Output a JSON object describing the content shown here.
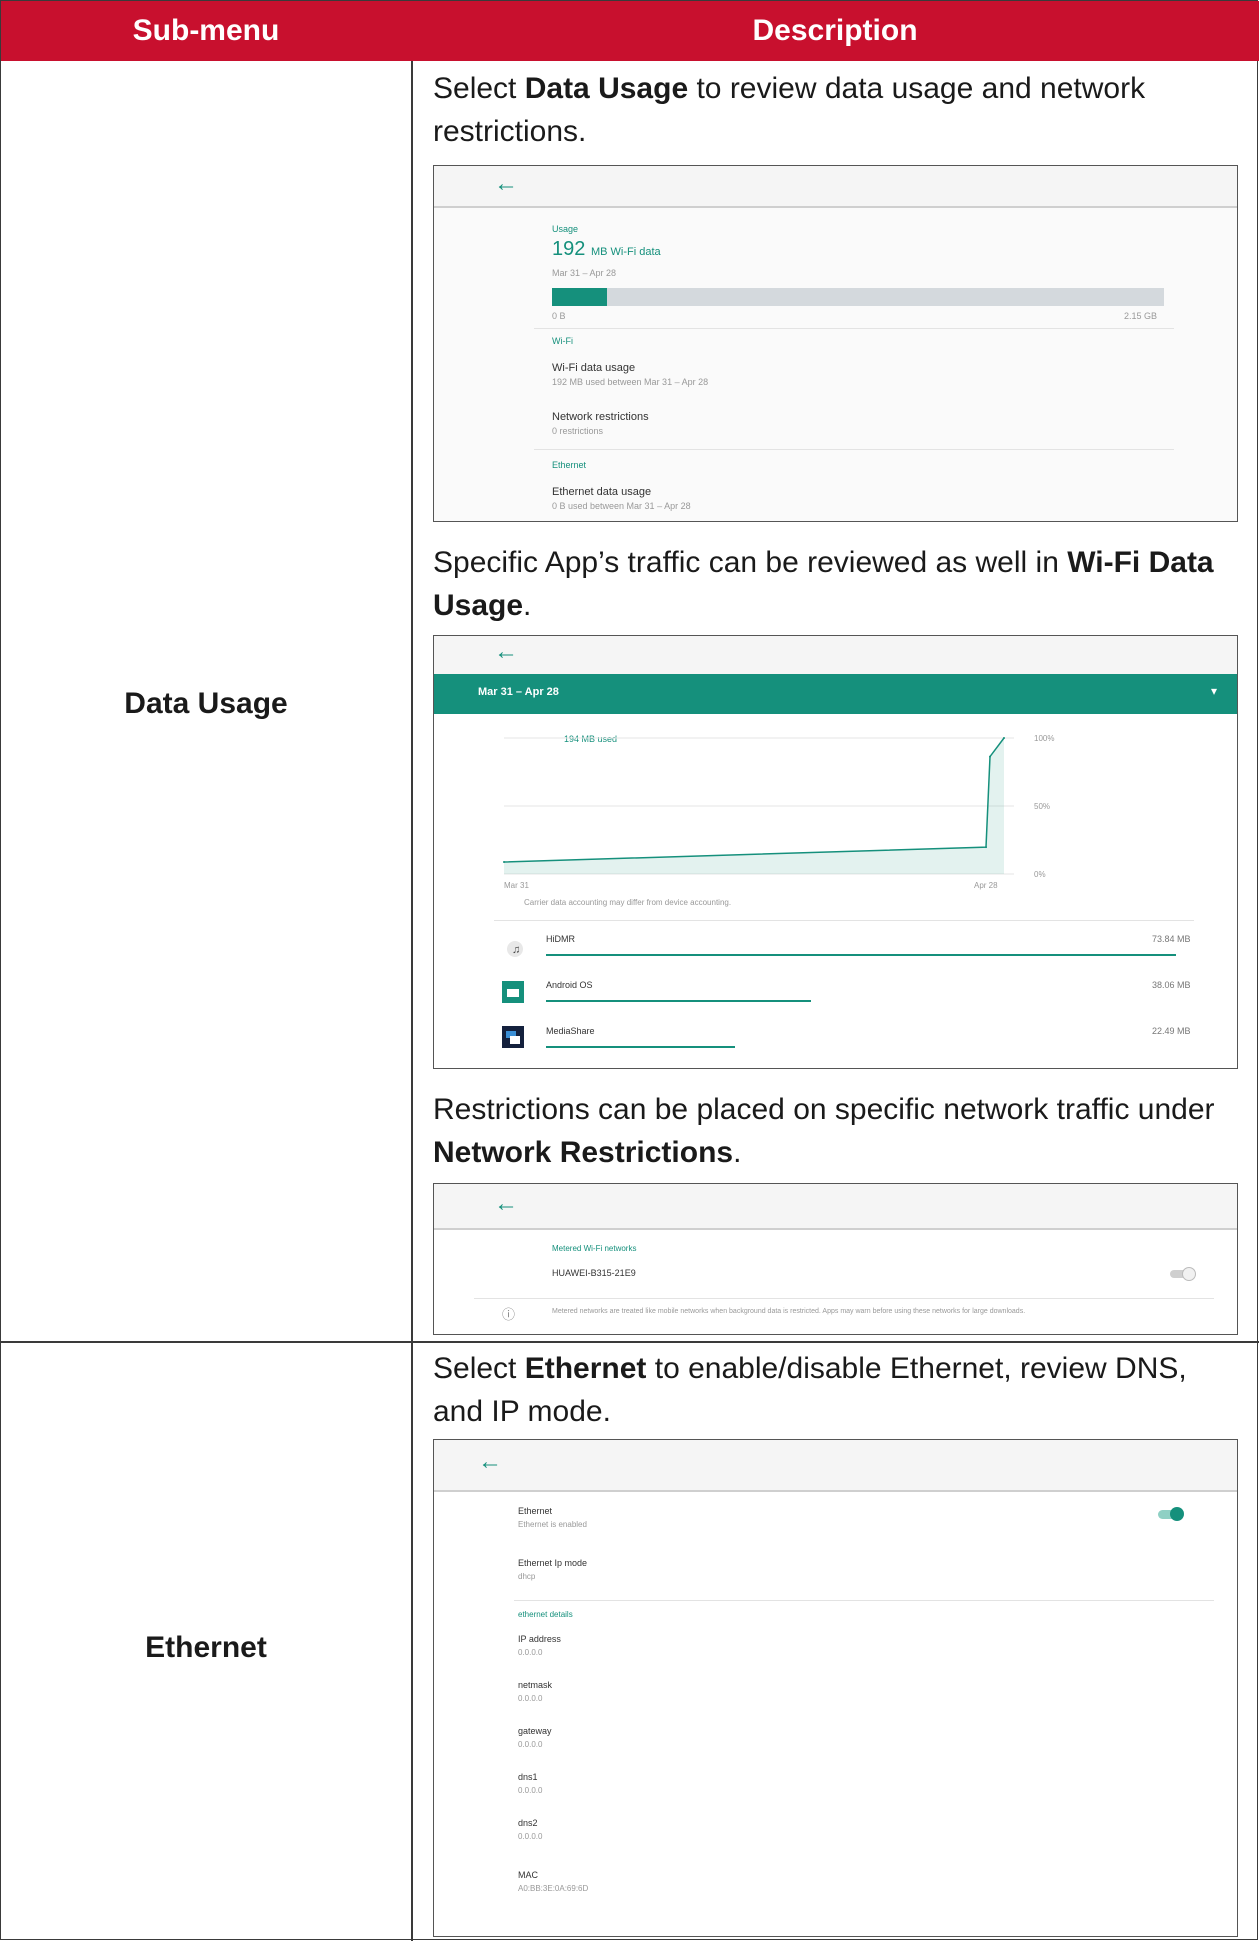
{
  "header": {
    "col1": "Sub-menu",
    "col2": "Description"
  },
  "rows": [
    {
      "label": "Data Usage",
      "p1": {
        "pre": "Select ",
        "bold": "Data Usage",
        "post": " to review data usage and network restrictions."
      },
      "p2": {
        "pre": "Specific App’s traffic can be reviewed as well in ",
        "bold": "Wi-Fi Data Usage",
        "post": "."
      },
      "p3": {
        "pre": "Restrictions can be placed on specific network traffic under ",
        "bold": "Network Restrictions",
        "post": "."
      }
    },
    {
      "label": "Ethernet",
      "p1": {
        "pre": "Select ",
        "bold": "Ethernet",
        "post": " to enable/disable Ethernet, review DNS, and IP mode."
      }
    }
  ],
  "shot1": {
    "back_icon": "arrow-left",
    "usage_header": "Usage",
    "big_value": "192",
    "big_unit": "MB Wi-Fi data",
    "date_range": "Mar 31 – Apr 28",
    "bar_fraction": 0.09,
    "bar_min": "0 B",
    "bar_max": "2.15 GB",
    "wifi_header": "Wi-Fi",
    "wifi_title": "Wi-Fi data usage",
    "wifi_sub": "192 MB used between Mar 31 – Apr 28",
    "net_title": "Network restrictions",
    "net_sub": "0 restrictions",
    "eth_header": "Ethernet",
    "eth_title": "Ethernet data usage",
    "eth_sub": "0 B used between Mar 31 – Apr 28"
  },
  "shot2": {
    "cycle": "Mar 31 – Apr 28",
    "used": "194 MB used",
    "y_labels": [
      "100%",
      "50%",
      "0%"
    ],
    "x_labels": [
      "Mar 31",
      "Apr 28"
    ],
    "note": "Carrier data accounting may differ from device accounting.",
    "apps": [
      {
        "name": "HiDMR",
        "size": "73.84 MB",
        "fraction": 1.0
      },
      {
        "name": "Android OS",
        "size": "38.06 MB",
        "fraction": 0.42
      },
      {
        "name": "MediaShare",
        "size": "22.49 MB",
        "fraction": 0.3
      }
    ],
    "chart_data": {
      "type": "area",
      "x": [
        "Mar 31",
        "Apr 28"
      ],
      "values_pct": [
        0,
        12,
        85,
        100
      ]
    }
  },
  "shot3": {
    "section": "Metered Wi-Fi networks",
    "network": "HUAWEI-B315-21E9",
    "info": "Metered networks are treated like mobile networks when background data is restricted. Apps may warn before using these networks for large downloads."
  },
  "shot4": {
    "items": [
      {
        "title": "Ethernet",
        "sub": "Ethernet is enabled"
      },
      {
        "title": "Ethernet Ip mode",
        "sub": "dhcp"
      }
    ],
    "details_header": "ethernet details",
    "details": [
      {
        "title": "IP address",
        "sub": "0.0.0.0"
      },
      {
        "title": "netmask",
        "sub": "0.0.0.0"
      },
      {
        "title": "gateway",
        "sub": "0.0.0.0"
      },
      {
        "title": "dns1",
        "sub": "0.0.0.0"
      },
      {
        "title": "dns2",
        "sub": "0.0.0.0"
      },
      {
        "title": "MAC",
        "sub": "A0:BB:3E:0A:69:6D"
      }
    ]
  },
  "colors": {
    "header_red": "#c8102e",
    "accent_teal": "#15907c"
  }
}
